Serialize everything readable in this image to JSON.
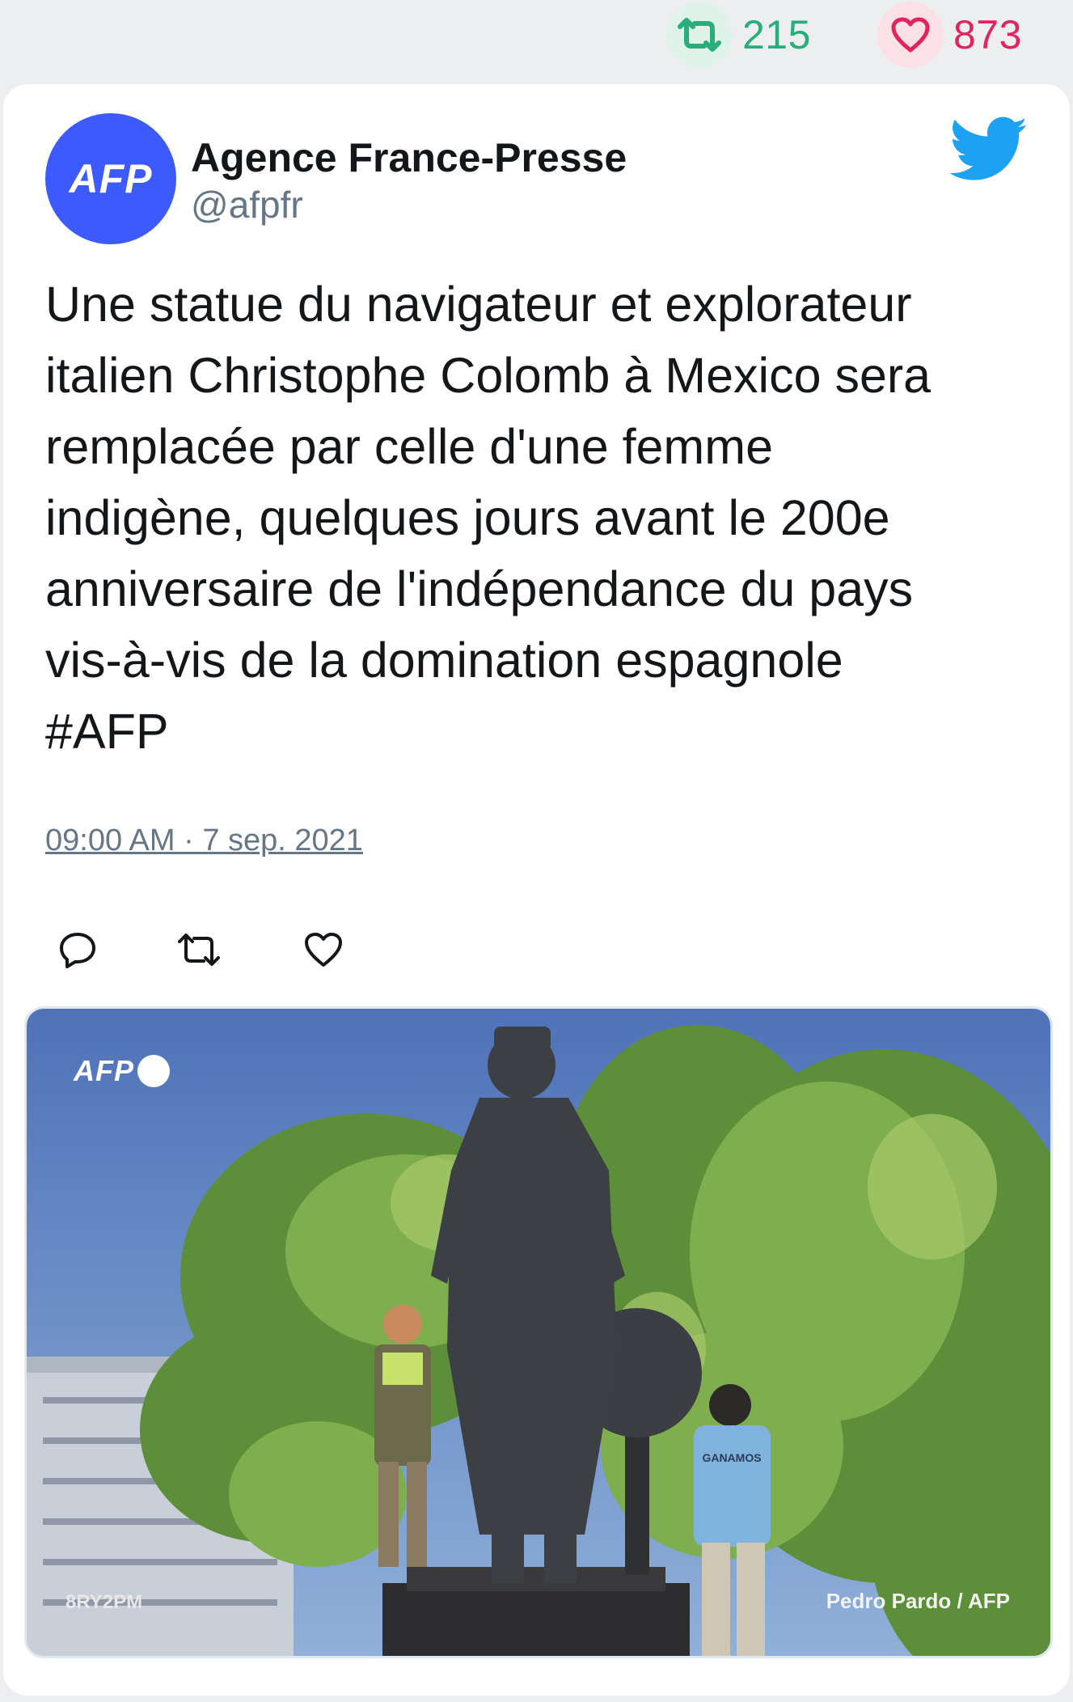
{
  "stats": {
    "retweets": "215",
    "likes": "873",
    "retweet_color": "#27ae7c",
    "like_color": "#e0245e",
    "retweet_icon": "retweet-icon",
    "like_icon": "heart-icon"
  },
  "tweet": {
    "author_name": "Agence France-Presse",
    "author_handle": "@afpfr",
    "avatar_text": "AFP",
    "avatar_color": "#3d5afe",
    "platform_icon": "twitter-bird-icon",
    "text": "Une statue du navigateur et explorateur\nitalien Christophe Colomb à Mexico sera\nremplacée par celle d'une femme\nindigène, quelques jours avant le 200e\nanniversaire de l'indépendance du pays\nvis-à-vis de la domination espagnole\n#AFP",
    "timestamp": "09:00 AM · 7 sep. 2021"
  },
  "actions": {
    "reply_icon": "reply-icon",
    "retweet_icon": "retweet-icon",
    "like_icon": "heart-icon"
  },
  "photo": {
    "watermark": "AFP",
    "credit": "Pedro Pardo / AFP",
    "code": "8RY2PM",
    "shirt_text": "GANAMOS"
  }
}
